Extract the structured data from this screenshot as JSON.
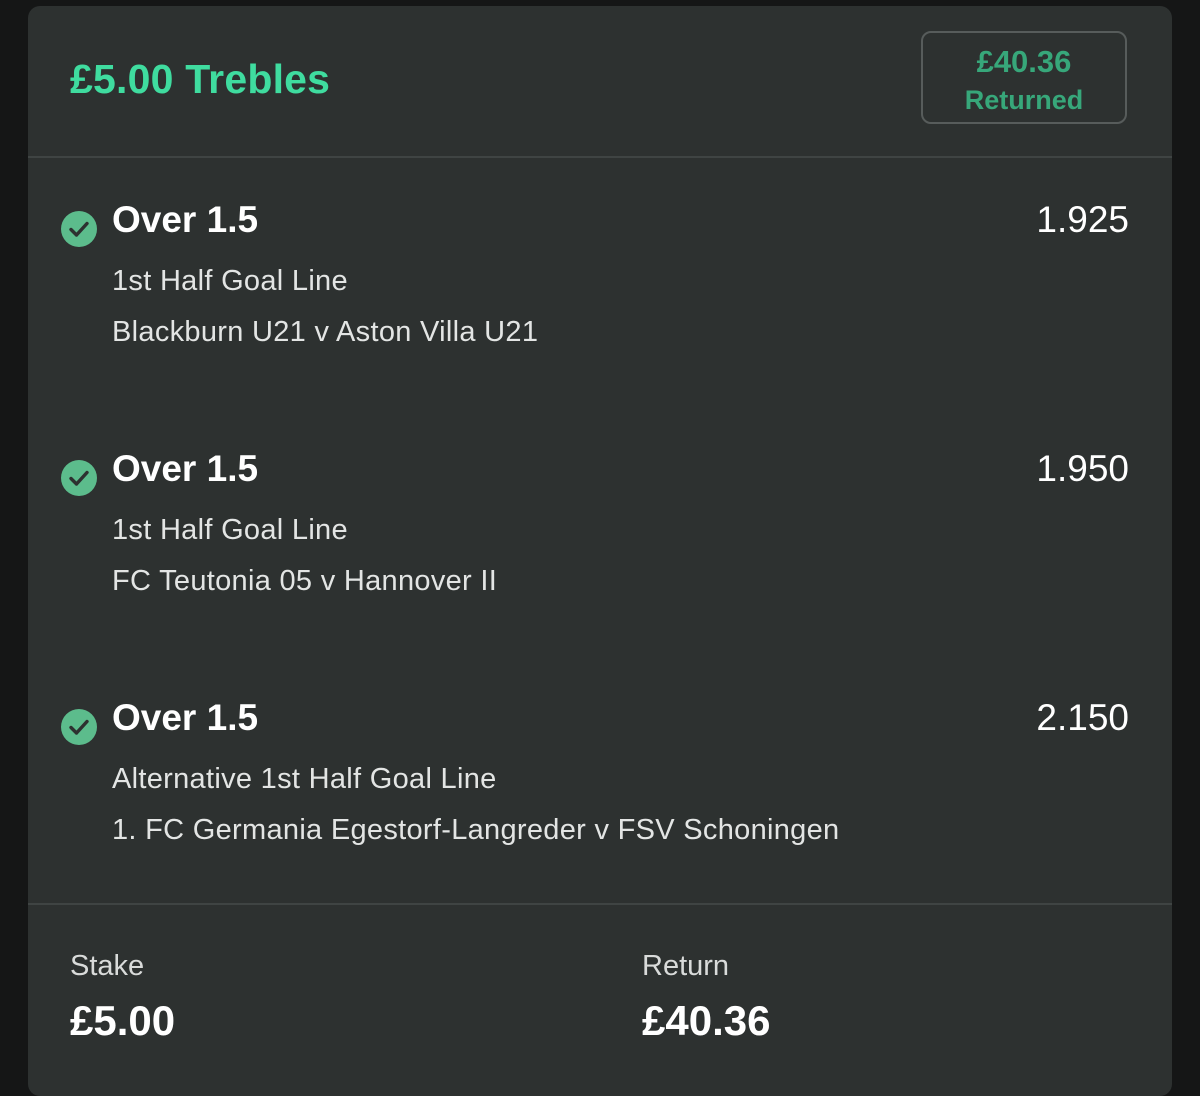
{
  "bet": {
    "title": "£5.00 Trebles",
    "returned_amount": "£40.36",
    "returned_label": "Returned"
  },
  "selections": [
    {
      "status_icon": "check-circle-icon",
      "selection": "Over 1.5",
      "odds": "1.925",
      "market": "1st Half Goal Line",
      "event": "Blackburn U21 v Aston Villa U21"
    },
    {
      "status_icon": "check-circle-icon",
      "selection": "Over 1.5",
      "odds": "1.950",
      "market": "1st Half Goal Line",
      "event": "FC Teutonia 05 v Hannover II"
    },
    {
      "status_icon": "check-circle-icon",
      "selection": "Over 1.5",
      "odds": "2.150",
      "market": "Alternative 1st Half Goal Line",
      "event": "1. FC Germania Egestorf-Langreder v FSV Schoningen"
    }
  ],
  "footer": {
    "stake_label": "Stake",
    "stake_value": "£5.00",
    "return_label": "Return",
    "return_value": "£40.36"
  },
  "colors": {
    "accent_green": "#3fdc9f",
    "returned_green": "#37a77a",
    "check_green": "#5cbc8c",
    "card_background": "#2d3130"
  }
}
